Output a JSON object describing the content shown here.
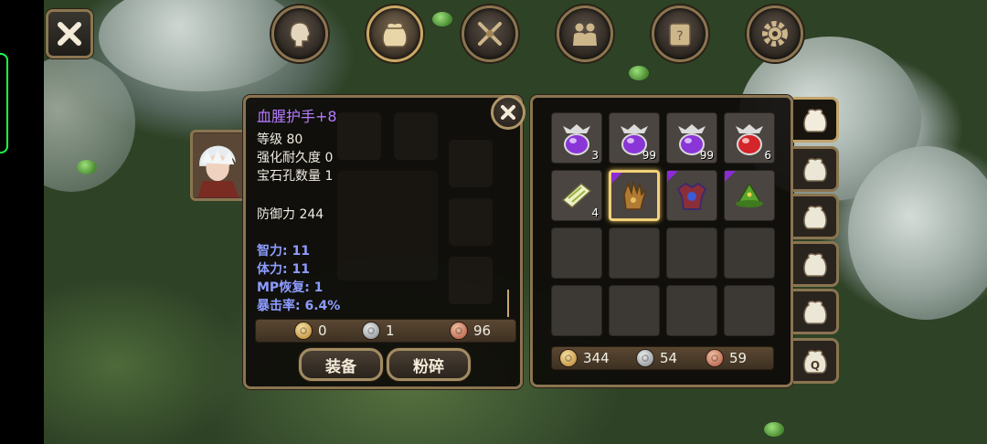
{
  "top_nav": [
    {
      "name": "character",
      "icon": "head-silhouette-icon",
      "active": false
    },
    {
      "name": "inventory",
      "icon": "bag-icon",
      "active": true
    },
    {
      "name": "skills",
      "icon": "crossed-swords-icon",
      "active": false
    },
    {
      "name": "party",
      "icon": "people-icon",
      "active": false
    },
    {
      "name": "quests",
      "icon": "scroll-icon",
      "active": false
    },
    {
      "name": "settings",
      "icon": "gear-icon",
      "active": false
    }
  ],
  "item_detail": {
    "title": "血腥护手+8",
    "level": "等级 80",
    "durability": "强化耐久度 0",
    "sockets": "宝石孔数量 1",
    "defense": "防御力 244",
    "stats": [
      "智力: 11",
      "体力: 11",
      "MP恢复: 1",
      "暴击率: 6.4%"
    ],
    "price": {
      "gold": "0",
      "silver": "1",
      "copper": "96"
    },
    "buttons": {
      "equip": "装备",
      "smash": "粉碎"
    }
  },
  "inventory": {
    "cells": [
      {
        "icon": "purple-potion-icon",
        "count": "3",
        "rare": false
      },
      {
        "icon": "purple-potion-icon",
        "count": "99",
        "rare": false
      },
      {
        "icon": "purple-potion-icon",
        "count": "99",
        "rare": false
      },
      {
        "icon": "red-potion-icon",
        "count": "6",
        "rare": false
      },
      {
        "icon": "scroll-item-icon",
        "count": "4",
        "rare": false
      },
      {
        "icon": "gauntlet-icon",
        "count": "",
        "rare": true,
        "selected": true
      },
      {
        "icon": "armor-icon",
        "count": "",
        "rare": true
      },
      {
        "icon": "green-hat-icon",
        "count": "",
        "rare": true
      }
    ],
    "empty_cells": 8,
    "money": {
      "gold": "344",
      "silver": "54",
      "copper": "59"
    }
  },
  "side_tabs": [
    {
      "icon": "bag-icon",
      "active": true
    },
    {
      "icon": "bag-icon",
      "active": false
    },
    {
      "icon": "bag-icon",
      "active": false
    },
    {
      "icon": "bag-icon",
      "active": false
    },
    {
      "icon": "bag-icon",
      "active": false
    },
    {
      "icon": "quest-bag-icon",
      "label": "Q",
      "active": false
    }
  ],
  "colors": {
    "frame": "#8a7450",
    "rare": "#8b2ad6",
    "stat_blue": "#8d9cff",
    "title_purple": "#b57cff"
  }
}
